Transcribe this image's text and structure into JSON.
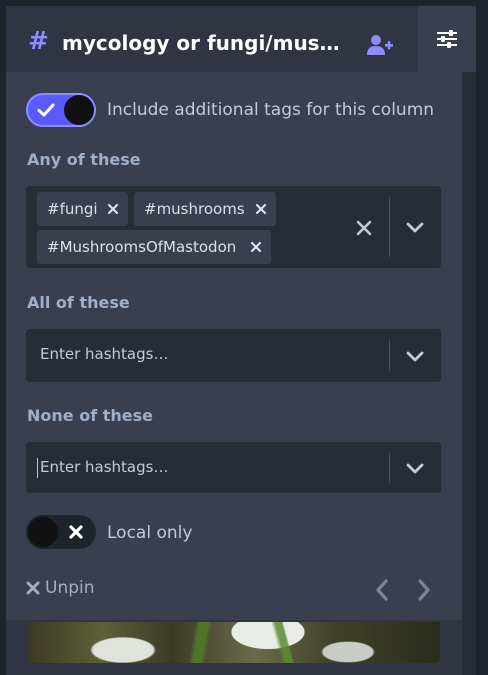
{
  "header": {
    "hash_symbol": "#",
    "title": "mycology or fungi/mushrooms",
    "follow_icon": "user-plus-icon",
    "settings_icon": "sliders-icon"
  },
  "settings": {
    "include_additional_tags": {
      "label": "Include additional tags for this column",
      "enabled": true
    },
    "any_of": {
      "title": "Any of these",
      "tags": [
        "#fungi",
        "#mushrooms",
        "#MushroomsOfMastodon"
      ]
    },
    "all_of": {
      "title": "All of these",
      "placeholder": "Enter hashtags…"
    },
    "none_of": {
      "title": "None of these",
      "placeholder": "Enter hashtags…"
    },
    "local_only": {
      "label": "Local only",
      "enabled": false
    },
    "unpin": {
      "label": "Unpin",
      "icon": "x-icon"
    }
  },
  "colors": {
    "accent": "#595aff",
    "accent_light": "#8c8dff",
    "panel_bg": "#393f4f",
    "input_bg": "#282c37",
    "text_muted": "#a0aec8"
  }
}
